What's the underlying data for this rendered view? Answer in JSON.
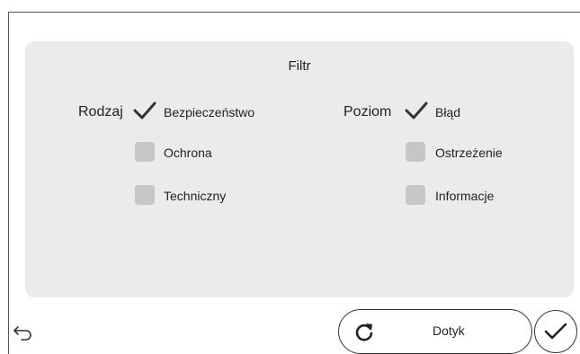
{
  "filter": {
    "title": "Filtr",
    "type": {
      "label": "Rodzaj",
      "options": [
        {
          "label": "Bezpieczeństwo",
          "checked": true
        },
        {
          "label": "Ochrona",
          "checked": false
        },
        {
          "label": "Techniczny",
          "checked": false
        }
      ]
    },
    "level": {
      "label": "Poziom",
      "options": [
        {
          "label": "Błąd",
          "checked": true
        },
        {
          "label": "Ostrzeżenie",
          "checked": false
        },
        {
          "label": "Informacje",
          "checked": false
        }
      ]
    }
  },
  "footer": {
    "back_icon": "back-arrow-icon",
    "touch_label": "Dotyk",
    "touch_icon": "refresh-icon",
    "confirm_icon": "check-icon"
  },
  "colors": {
    "panel_bg": "#ebebeb",
    "checkbox_bg": "#c6c6c6",
    "checkmark": "#333333"
  }
}
